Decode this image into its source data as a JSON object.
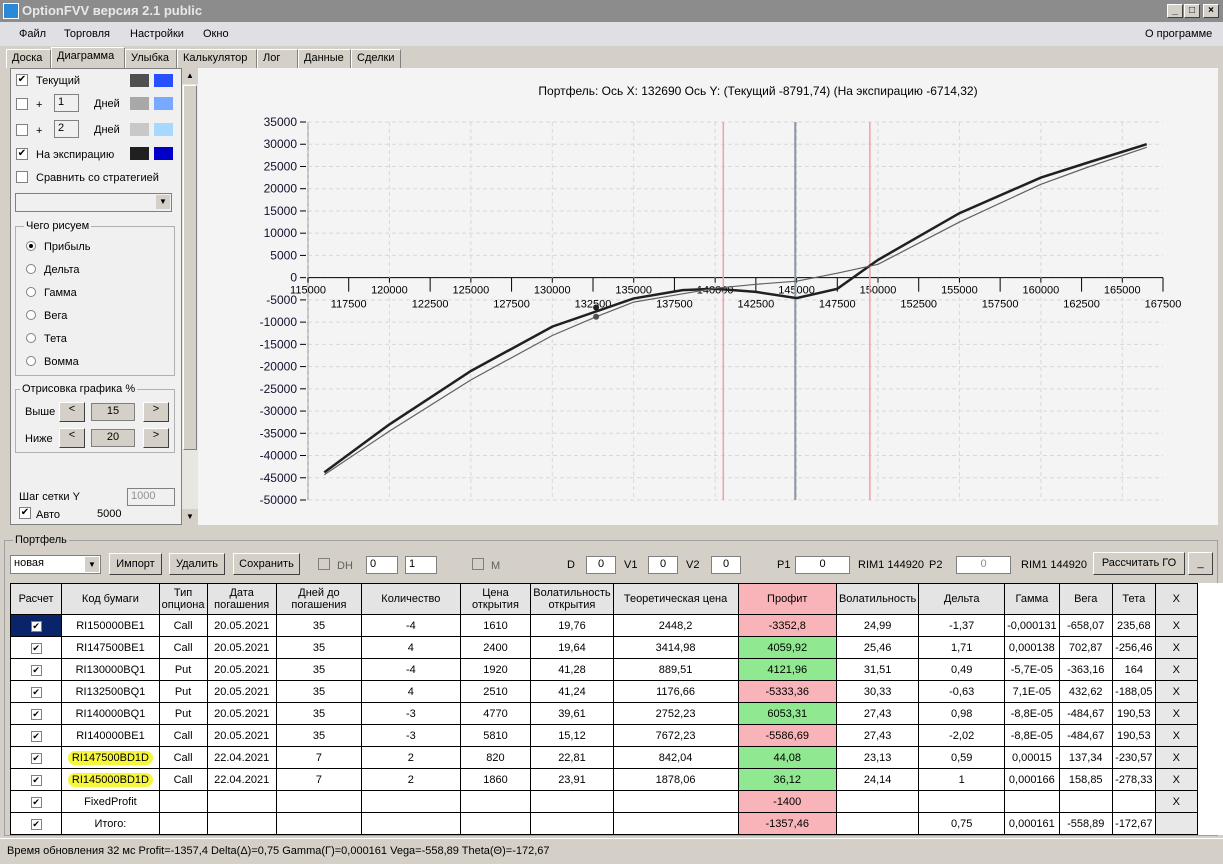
{
  "window": {
    "title": "OptionFVV версия 2.1 public",
    "minimize": "_",
    "maximize": "□",
    "close": "×"
  },
  "menu": {
    "items": [
      "Файл",
      "Торговля",
      "Настройки",
      "Окно"
    ],
    "about": "О программе"
  },
  "tabs": [
    "Доска",
    "Диаграмма",
    "Улыбка",
    "Калькулятор",
    "Лог",
    "Данные",
    "Сделки"
  ],
  "left": {
    "current": "Текущий",
    "plus": "+",
    "days": "Дней",
    "day1": "1",
    "day2": "2",
    "expiration": "На экспирацию",
    "compare": "Сравнить со стратегией",
    "colors": {
      "current": [
        "#505050",
        "#2850ff"
      ],
      "d1": [
        "#a8a8a8",
        "#78a8ff"
      ],
      "d2": [
        "#c8c8c8",
        "#a8d8ff"
      ],
      "exp": [
        "#202020",
        "#0000c8"
      ]
    },
    "draw_group": "Чего рисуем",
    "draw_options": [
      "Прибыль",
      "Дельта",
      "Гамма",
      "Вега",
      "Тета",
      "Вомма"
    ],
    "render_group": "Отрисовка графика %",
    "above": "Выше",
    "above_val": "15",
    "below": "Ниже",
    "below_val": "20",
    "grid_step": "Шаг сетки Y",
    "grid_val": "1000",
    "auto": "Авто",
    "auto_val": "5000"
  },
  "chart_data": {
    "type": "line",
    "title": "Портфель: Ось X: 132690 Ось Y:  (Текущий -8791,74)  (На экспирацию -6714,32)",
    "xlim": [
      115000,
      167500
    ],
    "ylim": [
      -50000,
      35000
    ],
    "xticks_top": [
      "115000",
      "120000",
      "125000",
      "130000",
      "135000",
      "140000",
      "145000",
      "150000",
      "155000",
      "160000",
      "165000"
    ],
    "xticks_bottom": [
      "117500",
      "122500",
      "127500",
      "132500",
      "137500",
      "142500",
      "147500",
      "152500",
      "157500",
      "162500",
      "167500"
    ],
    "yticks": [
      "35000",
      "30000",
      "25000",
      "20000",
      "15000",
      "10000",
      "5000",
      "0",
      "-5000",
      "-10000",
      "-15000",
      "-20000",
      "-25000",
      "-30000",
      "-35000",
      "-40000",
      "-45000",
      "-50000"
    ],
    "vlines": {
      "red": [
        140500,
        149500
      ],
      "gray": [
        144920
      ]
    },
    "cursor": {
      "x": 132690,
      "current": -8791.74,
      "expiration": -6714.32
    },
    "series": [
      {
        "name": "На экспирацию",
        "color": "#202020",
        "x": [
          116000,
          120000,
          125000,
          130000,
          135000,
          138000,
          140000,
          142500,
          145000,
          147500,
          150000,
          155000,
          160000,
          163000,
          166500
        ],
        "y": [
          -43800,
          -33000,
          -21000,
          -11000,
          -4700,
          -2800,
          -2500,
          -3200,
          -4600,
          -2500,
          4000,
          14500,
          22500,
          26000,
          30000
        ]
      },
      {
        "name": "Текущий",
        "color": "#606060",
        "x": [
          116000,
          120000,
          125000,
          130000,
          132690,
          135000,
          140000,
          142500,
          145000,
          147500,
          150000,
          155000,
          160000,
          163000,
          166500
        ],
        "y": [
          -44300,
          -34500,
          -23000,
          -13000,
          -8800,
          -5500,
          -2400,
          -1500,
          -800,
          1000,
          3000,
          12500,
          21000,
          25000,
          29300
        ]
      }
    ]
  },
  "portfolio": {
    "title": "Портфель",
    "select": "новая",
    "import": "Импорт",
    "delete": "Удалить",
    "save": "Сохранить",
    "dh": "DH",
    "spin1": "0",
    "spin2": "1",
    "m": "M",
    "d": "D",
    "d_val": "0",
    "v1": "V1",
    "v1_val": "0",
    "v2": "V2",
    "v2_val": "0",
    "p1": "P1",
    "p1_val": "0",
    "p1_info": "RIM1 144920",
    "p2": "P2",
    "p2_val": "0",
    "p2_info": "RIM1 144920",
    "calc": "Рассчитать ГО",
    "min": "_",
    "headers": [
      "Расчет",
      "Код бумаги",
      "Тип опциона",
      "Дата погашения",
      "Дней до погашения",
      "Количество",
      "Цена открытия",
      "Волатильность открытия",
      "Теоретическая цена",
      "Профит",
      "Волатильность",
      "Дельта",
      "Гамма",
      "Вега",
      "Тета",
      "X"
    ],
    "rows": [
      [
        "RI150000BE1",
        "Call",
        "20.05.2021",
        "35",
        "-4",
        "1610",
        "19,76",
        "2448,2",
        "-3352,8",
        "24,99",
        "-1,37",
        "-0,000131",
        "-658,07",
        "235,68"
      ],
      [
        "RI147500BE1",
        "Call",
        "20.05.2021",
        "35",
        "4",
        "2400",
        "19,64",
        "3414,98",
        "4059,92",
        "25,46",
        "1,71",
        "0,000138",
        "702,87",
        "-256,46"
      ],
      [
        "RI130000BQ1",
        "Put",
        "20.05.2021",
        "35",
        "-4",
        "1920",
        "41,28",
        "889,51",
        "4121,96",
        "31,51",
        "0,49",
        "-5,7E-05",
        "-363,16",
        "164"
      ],
      [
        "RI132500BQ1",
        "Put",
        "20.05.2021",
        "35",
        "4",
        "2510",
        "41,24",
        "1176,66",
        "-5333,36",
        "30,33",
        "-0,63",
        "7,1E-05",
        "432,62",
        "-188,05"
      ],
      [
        "RI140000BQ1",
        "Put",
        "20.05.2021",
        "35",
        "-3",
        "4770",
        "39,61",
        "2752,23",
        "6053,31",
        "27,43",
        "0,98",
        "-8,8E-05",
        "-484,67",
        "190,53"
      ],
      [
        "RI140000BE1",
        "Call",
        "20.05.2021",
        "35",
        "-3",
        "5810",
        "15,12",
        "7672,23",
        "-5586,69",
        "27,43",
        "-2,02",
        "-8,8E-05",
        "-484,67",
        "190,53"
      ],
      [
        "RI147500BD1D",
        "Call",
        "22.04.2021",
        "7",
        "2",
        "820",
        "22,81",
        "842,04",
        "44,08",
        "23,13",
        "0,59",
        "0,00015",
        "137,34",
        "-230,57"
      ],
      [
        "RI145000BD1D",
        "Call",
        "22.04.2021",
        "7",
        "2",
        "1860",
        "23,91",
        "1878,06",
        "36,12",
        "24,14",
        "1",
        "0,000166",
        "158,85",
        "-278,33"
      ],
      [
        "FixedProfit",
        "",
        "",
        "",
        "",
        "",
        "",
        "",
        "-1400",
        "",
        "",
        "",
        "",
        ""
      ],
      [
        "Итого:",
        "",
        "",
        "",
        "",
        "",
        "",
        "",
        "-1357,46",
        "",
        "0,75",
        "0,000161",
        "-558,89",
        "-172,67"
      ]
    ],
    "check": "✔",
    "x": "X"
  },
  "status": "Время обновления 32 мс  Profit=-1357,4 Delta(Δ)=0,75 Gamma(Γ)=0,000161 Vega=-558,89 Theta(Θ)=-172,67"
}
